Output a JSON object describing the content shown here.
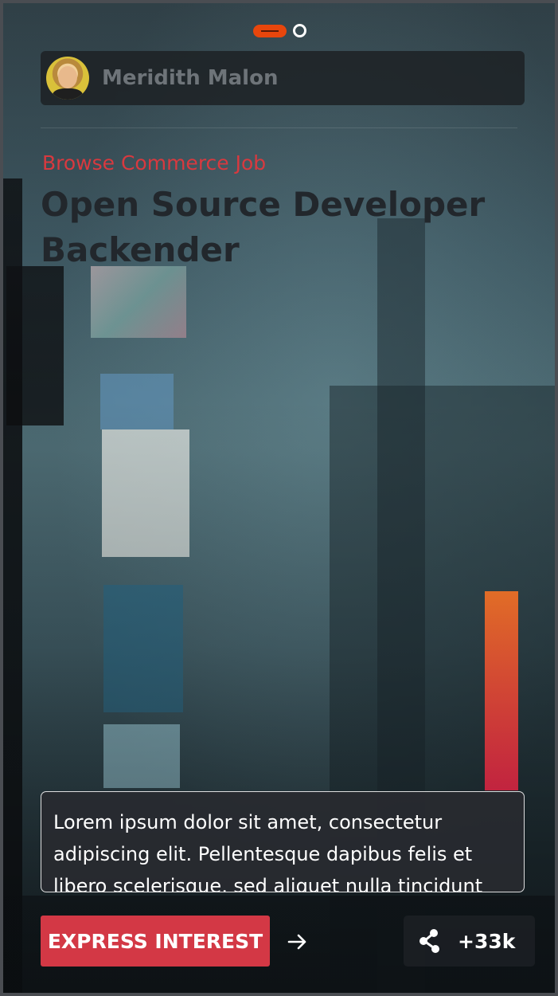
{
  "pager": {
    "active_index": 0,
    "count": 2
  },
  "user": {
    "name": "Meridith Malon"
  },
  "job": {
    "category": "Browse Commerce Job",
    "title": "Open Source Developer Backender",
    "description": "Lorem ipsum dolor sit amet, consectetur adipiscing elit. Pellentesque dapibus felis et libero scelerisque, sed aliquet nulla tincidunt"
  },
  "actions": {
    "cta_label": "EXPRESS INTEREST",
    "share_count": "+33k"
  },
  "icons": {
    "arrow": "arrow-right-icon",
    "share": "share-icon"
  },
  "colors": {
    "accent": "#d33845",
    "pager_active": "#e8460c"
  }
}
